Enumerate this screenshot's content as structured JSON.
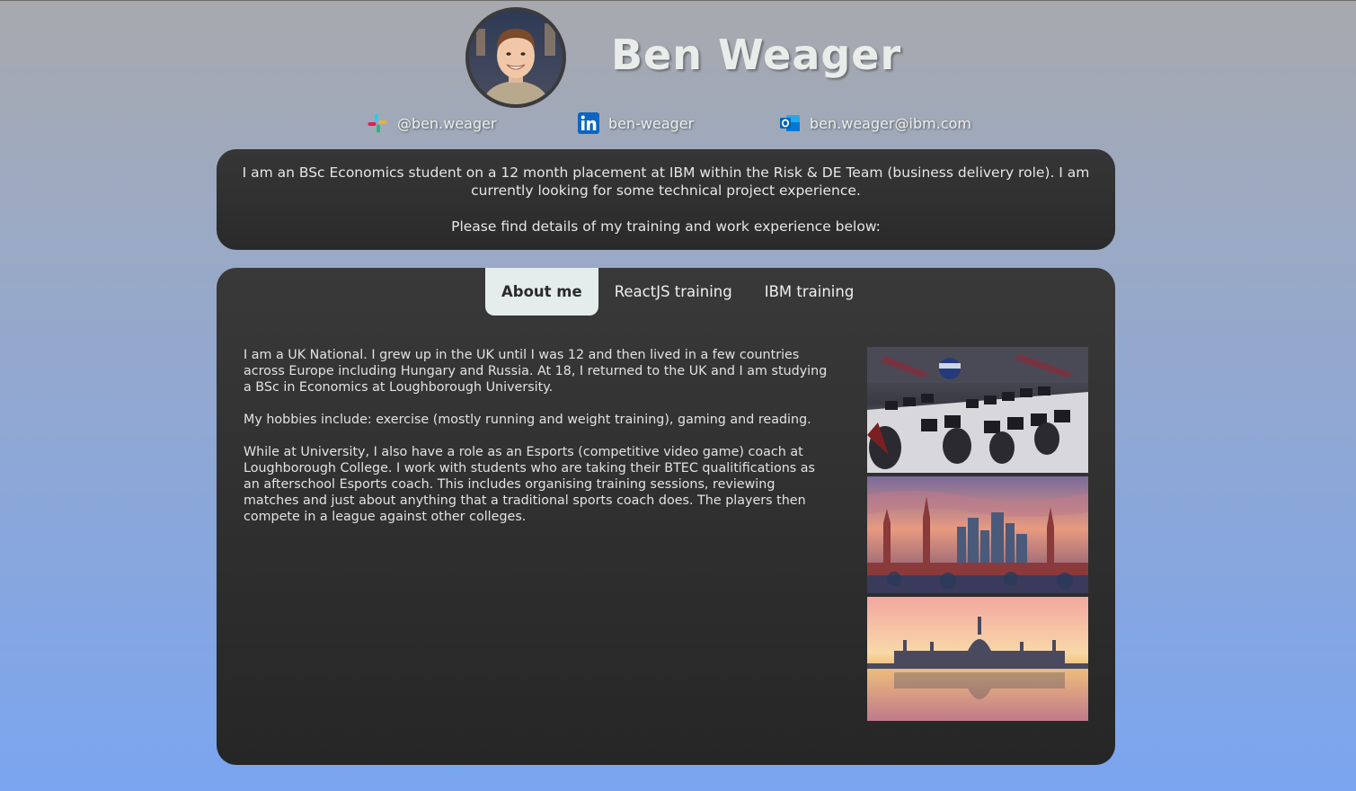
{
  "profile": {
    "name": "Ben Weager",
    "avatar_icon": "profile-photo"
  },
  "contacts": {
    "slack": {
      "icon": "slack-icon",
      "label": "@ben.weager"
    },
    "linkedin": {
      "icon": "linkedin-icon",
      "label": "ben-weager"
    },
    "email": {
      "icon": "outlook-icon",
      "label": "ben.weager@ibm.com"
    }
  },
  "intro": {
    "line1": "I am an BSc Economics student on a 12 month placement at IBM within the Risk & DE Team (business delivery role). I am currently looking for some technical project experience.",
    "line2": "Please find details of my training and work experience below:"
  },
  "tabs": [
    {
      "label": "About me",
      "active": true
    },
    {
      "label": "ReactJS training",
      "active": false
    },
    {
      "label": "IBM training",
      "active": false
    }
  ],
  "about": {
    "p1": "I am a UK National. I grew up in the UK until I was 12 and then lived in a few countries across Europe including Hungary and Russia. At 18, I returned to the UK and I am studying a BSc in Economics at Loughborough University.",
    "p2": "My hobbies include: exercise (mostly running and weight training), gaming and reading.",
    "p3": "While at University, I also have a role as an Esports (competitive video game) coach at Loughborough College. I work with students who are taking their BTEC qualitifications as an afterschool Esports coach. This includes organising training sessions, reviewing matches and just about anything that a traditional sports coach does. The players then compete in a league against other colleges."
  },
  "photos": [
    {
      "name": "esports-room-photo"
    },
    {
      "name": "moscow-skyline-photo"
    },
    {
      "name": "budapest-parliament-photo"
    }
  ],
  "colors": {
    "background_top": "#a7a9ad",
    "background_bottom": "#7aa5f0",
    "card": "#2f2f2f",
    "active_tab": "#e4ecec"
  }
}
